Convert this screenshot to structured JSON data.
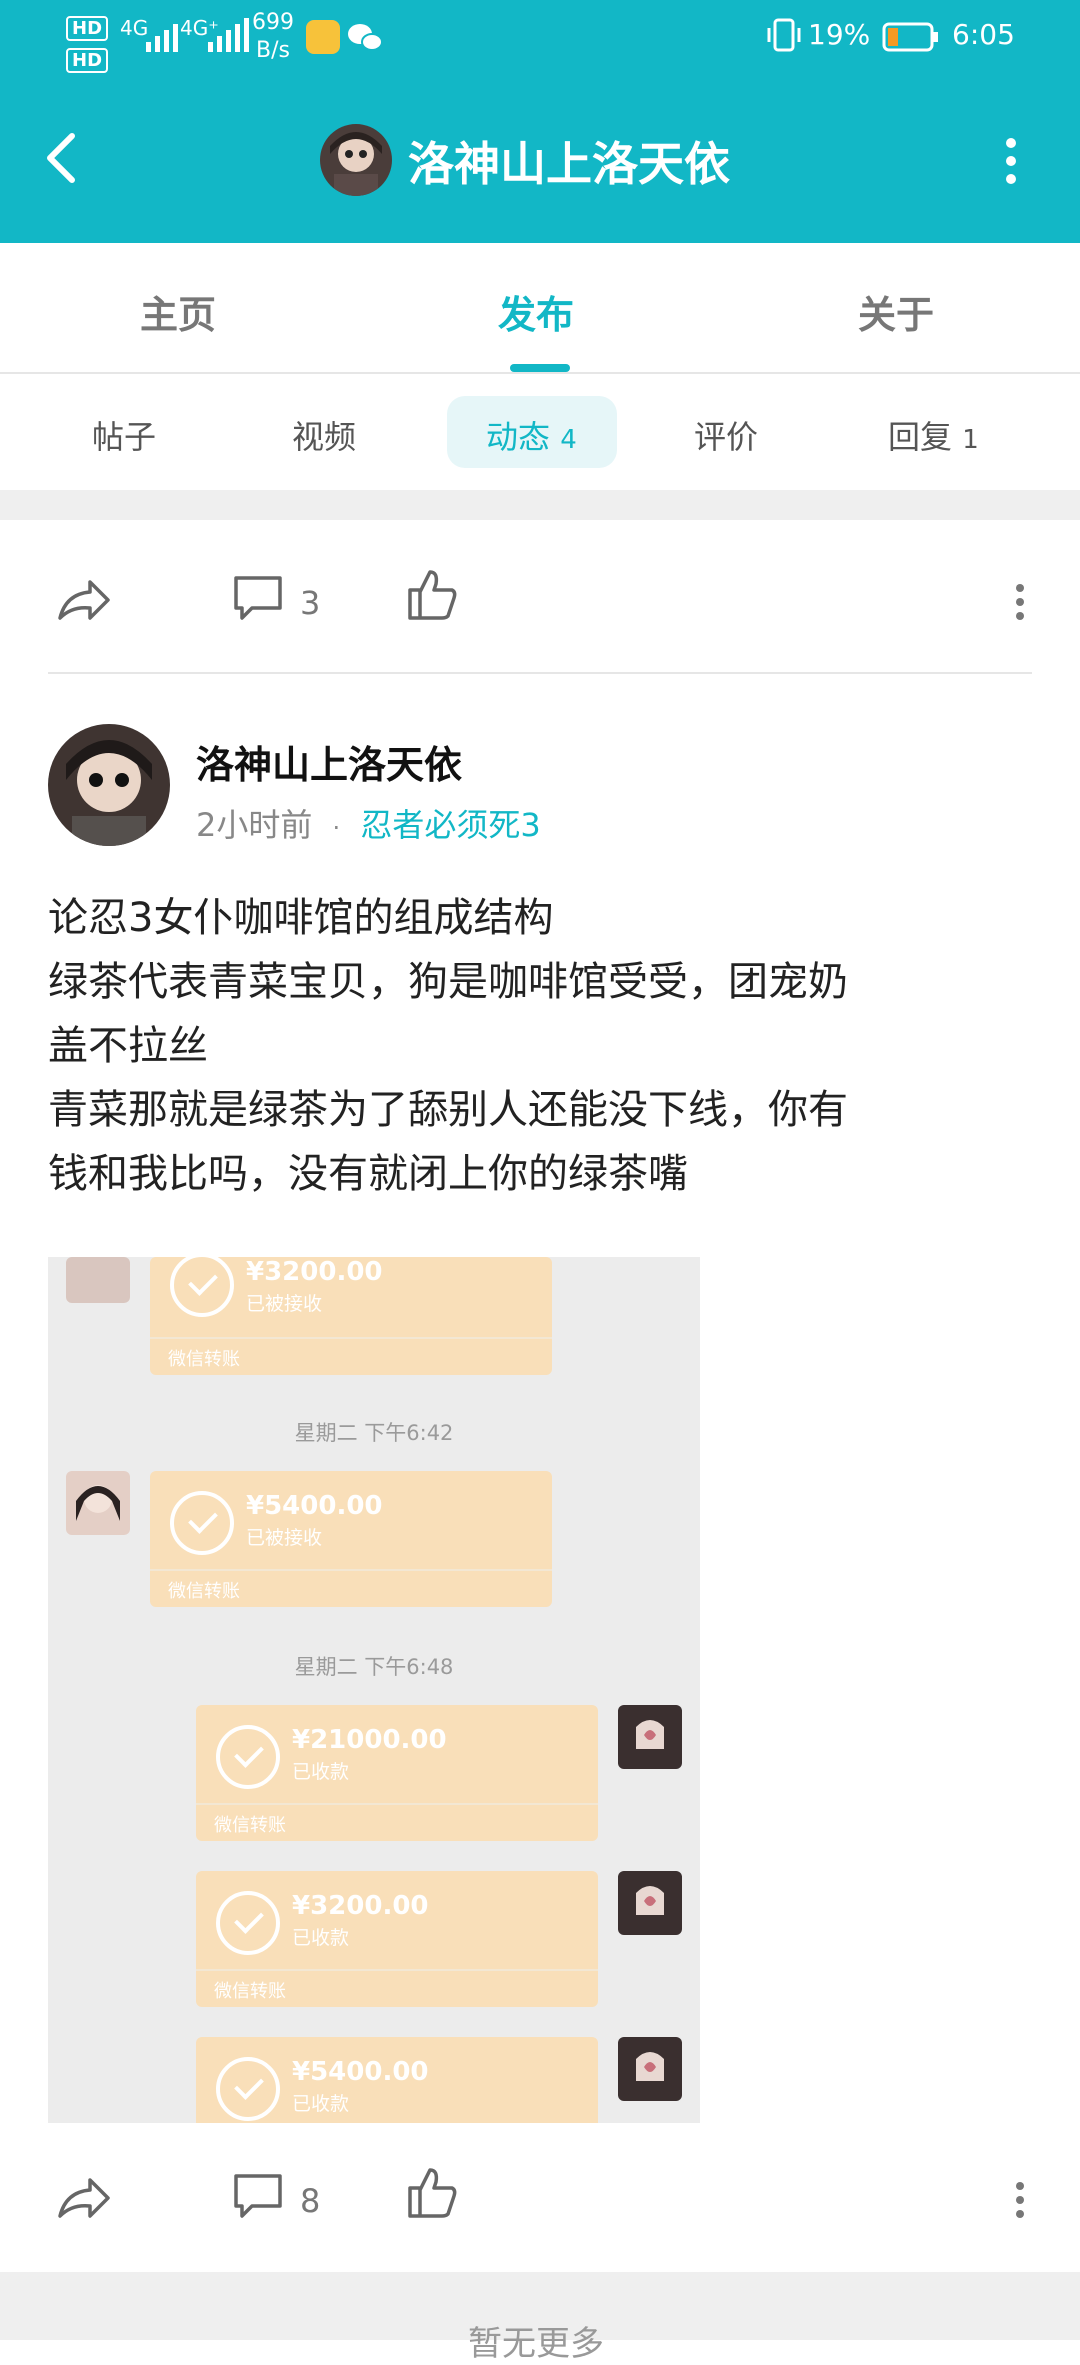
{
  "status_bar": {
    "hd1": "HD",
    "hd2": "HD",
    "sig1": "4G",
    "sig2": "4G⁺",
    "speed_value": "699",
    "speed_unit": "B/s",
    "battery": "19%",
    "time": "6:05"
  },
  "header": {
    "title": "洛神山上洛天依"
  },
  "tabs": [
    {
      "label": "主页"
    },
    {
      "label": "发布"
    },
    {
      "label": "关于"
    }
  ],
  "subtabs": [
    {
      "label": "帖子",
      "count": ""
    },
    {
      "label": "视频",
      "count": ""
    },
    {
      "label": "动态",
      "count": "4"
    },
    {
      "label": "评价",
      "count": ""
    },
    {
      "label": "回复",
      "count": "1"
    }
  ],
  "action_row_top": {
    "comment_count": "3"
  },
  "post": {
    "author": "洛神山上洛天依",
    "time": "2小时前",
    "separator": "·",
    "topic": "忍者必须死3",
    "lines": [
      "论忍3女仆咖啡馆的组成结构",
      "绿茶代表青菜宝贝，狗是咖啡馆受受，团宠奶",
      "盖不拉丝",
      "青菜那就是绿茶为了舔别人还能没下线，你有",
      "钱和我比吗，没有就闭上你的绿茶嘴"
    ]
  },
  "screenshot": {
    "transfers": [
      {
        "amount": "¥3200.00",
        "status": "已被接收",
        "footer": "微信转账"
      },
      {
        "amount": "¥5400.00",
        "status": "已被接收",
        "footer": "微信转账"
      },
      {
        "amount": "¥21000.00",
        "status": "已收款",
        "footer": "微信转账"
      },
      {
        "amount": "¥3200.00",
        "status": "已收款",
        "footer": "微信转账"
      },
      {
        "amount": "¥5400.00",
        "status": "已收款",
        "footer": ""
      }
    ],
    "times": [
      "星期二 下午6:42",
      "星期二 下午6:48"
    ]
  },
  "action_row_bottom": {
    "comment_count": "8"
  },
  "footer": {
    "text": "暂无更多"
  },
  "colors": {
    "accent": "#12b7c6",
    "transfer": "#f9dfb9"
  }
}
